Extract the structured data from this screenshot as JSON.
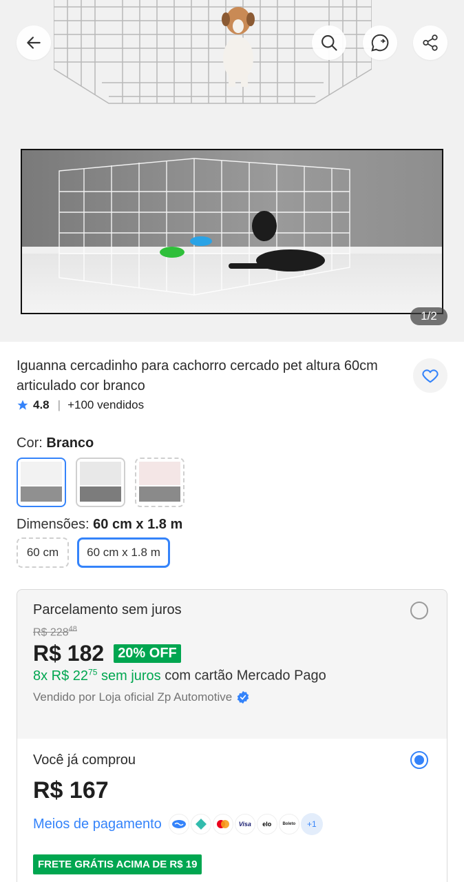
{
  "gallery": {
    "counter": "1/2",
    "icons": {
      "back": "arrow-left-icon",
      "search": "search-icon",
      "whatsapp": "whatsapp-share-icon",
      "share": "share-icon"
    }
  },
  "product": {
    "title": "Iguanna cercadinho para cachorro cercado pet altura 60cm articulado cor branco",
    "rating": "4.8",
    "sold": "+100 vendidos"
  },
  "variations": {
    "color_label": "Cor: ",
    "color_value": "Branco",
    "dimension_label": "Dimensões: ",
    "dimension_value": "60 cm x 1.8 m",
    "dimension_options": [
      "60 cm",
      "60 cm x 1.8 m"
    ]
  },
  "offer_installments": {
    "title": "Parcelamento sem juros",
    "old_price": "R$ 228",
    "old_price_cents": "48",
    "price": "R$ 182",
    "discount": "20% OFF",
    "installments_green": "8x R$ 22",
    "installments_cents": "75",
    "installments_green_suffix": " sem juros",
    "installments_rest": " com cartão Mercado Pago",
    "seller": "Vendido por Loja oficial Zp Automotive"
  },
  "offer_bought": {
    "title": "Você já comprou",
    "price": "R$ 167",
    "payment_link": "Meios de pagamento",
    "payment_icons": [
      "Visa",
      "elo",
      "Boleto"
    ],
    "payment_more": "+1",
    "shipping_badge": "FRETE GRÁTIS ACIMA DE R$ 19"
  },
  "colors": {
    "accent": "#3483fa",
    "green": "#00a650"
  }
}
